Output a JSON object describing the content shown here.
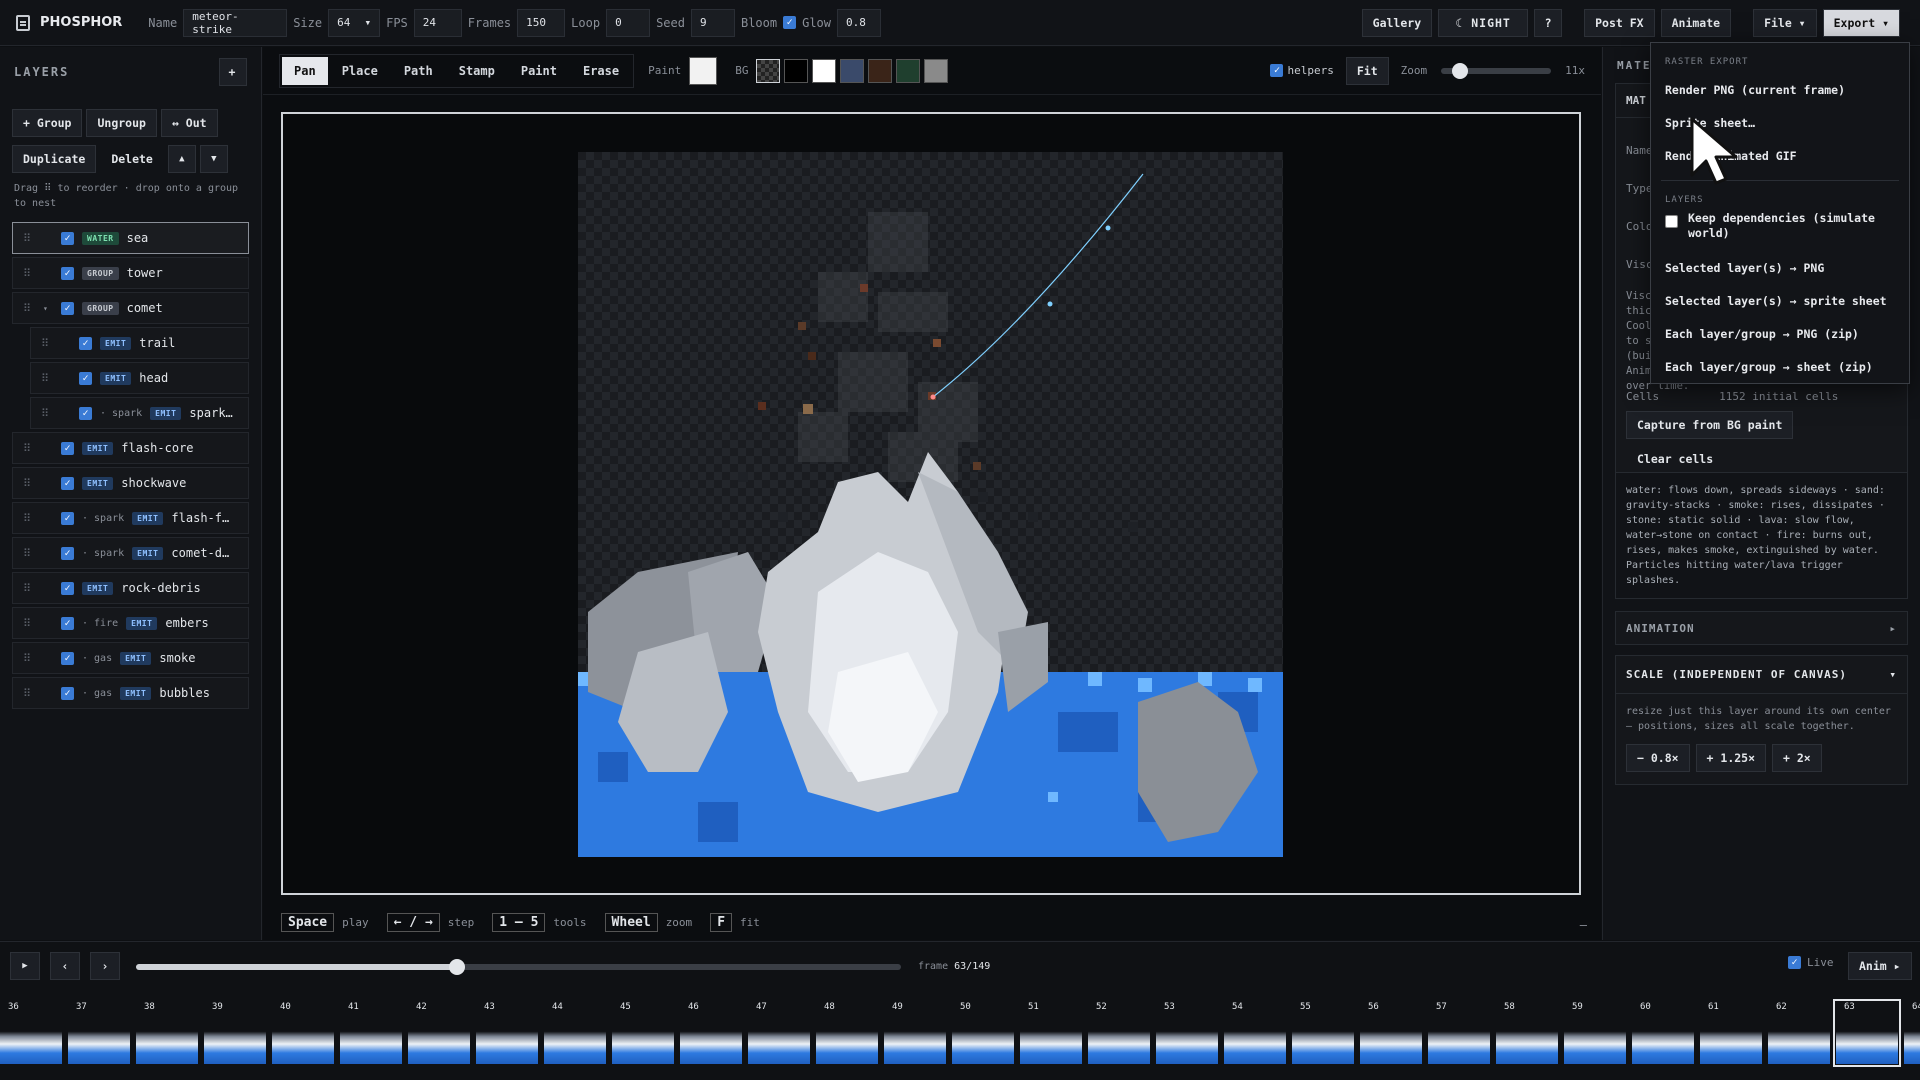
{
  "app": {
    "name": "PHOSPHOR"
  },
  "toolbar": {
    "name_label": "Name",
    "name_value": "meteor-strike",
    "size_label": "Size",
    "size_value": "64",
    "fps_label": "FPS",
    "fps_value": "24",
    "frames_label": "Frames",
    "frames_value": "150",
    "loop_label": "Loop",
    "loop_value": "0",
    "seed_label": "Seed",
    "seed_value": "9",
    "bloom_label": "Bloom",
    "glow_label": "Glow",
    "glow_value": "0.8",
    "gallery": "Gallery",
    "night": "☾ NIGHT",
    "help": "?",
    "postfx": "Post FX",
    "animate": "Animate",
    "file": "File ▾",
    "export": "Export ▾"
  },
  "layers_panel": {
    "title": "LAYERS",
    "add": "+",
    "group": "+ Group",
    "ungroup": "Ungroup",
    "out": "↔ Out",
    "duplicate": "Duplicate",
    "delete": "Delete",
    "up": "▲",
    "down": "▼",
    "hint": "Drag ⠿ to reorder · drop onto a group to nest",
    "items": [
      {
        "tag": "WATER",
        "tagtype": "water",
        "name": "sea",
        "prefix": "",
        "caret": "",
        "indent": 0,
        "selected": true
      },
      {
        "tag": "GROUP",
        "tagtype": "group",
        "name": "tower",
        "prefix": "",
        "caret": "",
        "indent": 0
      },
      {
        "tag": "GROUP",
        "tagtype": "group",
        "name": "comet",
        "prefix": "",
        "caret": "▾",
        "indent": 0
      },
      {
        "tag": "EMIT",
        "tagtype": "emit",
        "name": "trail",
        "prefix": "",
        "caret": "",
        "indent": 1
      },
      {
        "tag": "EMIT",
        "tagtype": "emit",
        "name": "head",
        "prefix": "",
        "caret": "",
        "indent": 1
      },
      {
        "tag": "EMIT",
        "tagtype": "emit",
        "name": "spark…",
        "prefix": "· spark",
        "caret": "",
        "indent": 1
      },
      {
        "tag": "EMIT",
        "tagtype": "emit",
        "name": "flash-core",
        "prefix": "",
        "caret": "",
        "indent": 0
      },
      {
        "tag": "EMIT",
        "tagtype": "emit",
        "name": "shockwave",
        "prefix": "",
        "caret": "",
        "indent": 0
      },
      {
        "tag": "EMIT",
        "tagtype": "emit",
        "name": "flash-f…",
        "prefix": "· spark",
        "caret": "",
        "indent": 0
      },
      {
        "tag": "EMIT",
        "tagtype": "emit",
        "name": "comet-d…",
        "prefix": "· spark",
        "caret": "",
        "indent": 0
      },
      {
        "tag": "EMIT",
        "tagtype": "emit",
        "name": "rock-debris",
        "prefix": "",
        "caret": "",
        "indent": 0
      },
      {
        "tag": "EMIT",
        "tagtype": "emit",
        "name": "embers",
        "prefix": "· fire",
        "caret": "",
        "indent": 0
      },
      {
        "tag": "EMIT",
        "tagtype": "emit",
        "name": "smoke",
        "prefix": "· gas",
        "caret": "",
        "indent": 0
      },
      {
        "tag": "EMIT",
        "tagtype": "emit",
        "name": "bubbles",
        "prefix": "· gas",
        "caret": "",
        "indent": 0
      }
    ]
  },
  "tools": {
    "items": [
      "Pan",
      "Place",
      "Path",
      "Stamp",
      "Paint",
      "Erase"
    ],
    "active": "Pan",
    "paint_label": "Paint",
    "bg_label": "BG",
    "bg_swatches": [
      "#2a2d33",
      "#000000",
      "#ffffff",
      "#3a4a6a",
      "#3a2418",
      "#1f3f2e",
      "#8a8a8a"
    ],
    "helpers": "helpers",
    "fit": "Fit",
    "zoom_label": "Zoom",
    "zoom_value": "11x",
    "zoom_level": 0.12
  },
  "shortcuts": [
    {
      "key": "Space",
      "label": "play"
    },
    {
      "key": "← / →",
      "label": "step"
    },
    {
      "key": "1 – 5",
      "label": "tools"
    },
    {
      "key": "Wheel",
      "label": "zoom"
    },
    {
      "key": "F",
      "label": "fit"
    }
  ],
  "shortcuts_close": "—",
  "right_panel": {
    "section_header": "MATE",
    "card_header": "MAT",
    "labels": [
      "Name",
      "Type",
      "Colo",
      "Visc"
    ],
    "desc_fragment": [
      "Visc",
      "thic",
      "Cool",
      "to s",
      "(bui",
      "Anim",
      "over time."
    ],
    "cells_label": "Cells",
    "cells_value": "1152 initial cells",
    "capture": "Capture from BG paint",
    "clear": "Clear cells",
    "legend_text": "water: flows down, spreads sideways · sand: gravity-stacks · smoke: rises, dissipates · stone: static solid · lava: slow flow, water→stone on contact · fire: burns out, rises, makes smoke, extinguished by water. Particles hitting water/lava trigger splashes.",
    "animation": "ANIMATION",
    "animation_arrow": "▸",
    "scale_title": "SCALE (INDEPENDENT OF CANVAS)",
    "scale_arrow": "▾",
    "scale_desc": "resize just this layer around its own center — positions, sizes all scale together.",
    "scale_buttons": [
      "− 0.8×",
      "+ 1.25×",
      "+ 2×"
    ]
  },
  "export_menu": {
    "raster_header": "RASTER EXPORT",
    "raster_items": [
      "Render PNG (current frame)",
      "Sprite sheet…",
      "Render animated GIF"
    ],
    "layers_header": "LAYERS",
    "keep_deps": "Keep dependencies (simulate world)",
    "layer_items": [
      "Selected layer(s) → PNG",
      "Selected layer(s) → sprite sheet",
      "Each layer/group → PNG (zip)",
      "Each layer/group → sheet (zip)"
    ]
  },
  "timeline": {
    "play": "▶",
    "prev": "‹",
    "next": "›",
    "frame_label": "frame",
    "frame_value": "63/149",
    "progress": 0.42,
    "live": "Live",
    "anim": "Anim ▸",
    "frames": [
      "36",
      "37",
      "38",
      "39",
      "40",
      "41",
      "42",
      "43",
      "44",
      "45",
      "46",
      "47",
      "48",
      "49",
      "50",
      "51",
      "52",
      "53",
      "54",
      "55",
      "56",
      "57",
      "58",
      "59",
      "60",
      "61",
      "62",
      "63",
      "64"
    ],
    "current": "63"
  }
}
